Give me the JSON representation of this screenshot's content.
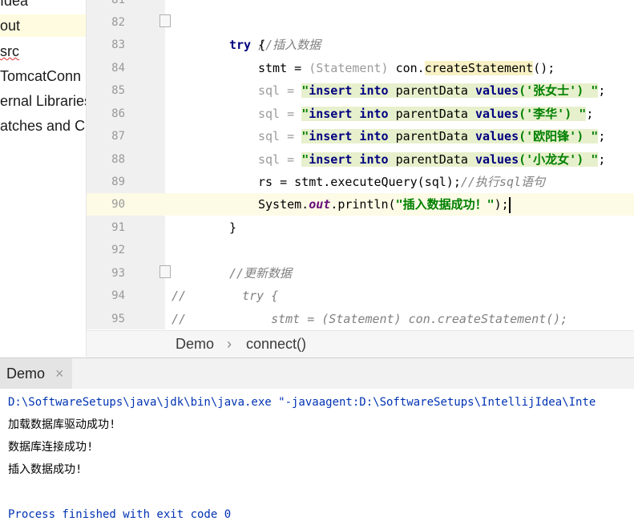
{
  "project_tree": {
    "items": [
      {
        "label": "Idea"
      },
      {
        "label": "out"
      },
      {
        "label": "src"
      },
      {
        "label": "TomcatConn"
      },
      {
        "label": "ernal Libraries"
      },
      {
        "label": "atches and Co"
      }
    ]
  },
  "editor": {
    "line_numbers": [
      "81",
      "82",
      "83",
      "84",
      "85",
      "86",
      "87",
      "88",
      "89",
      "90",
      "91",
      "92",
      "93",
      "94",
      "95"
    ],
    "current_line": "90",
    "lines": {
      "l82_comment": "//插入数据",
      "l83_try": "try",
      "l83_brace": " {",
      "l84_a": "stmt = ",
      "l84_cast": "(Statement)",
      "l84_b": " con.",
      "l84_call": "createStatement",
      "l84_c": "();",
      "l85_a": "sql = ",
      "l85_q": "\"",
      "l85_k1": "insert into",
      "l85_t": " parentData ",
      "l85_k2": "values",
      "l85_v": "('张女士')",
      "l85_q2": " \"",
      "l85_end": ";",
      "l86_v": "('李华')",
      "l87_v": "('欧阳锋')",
      "l88_v": "('小龙女')",
      "l89_a": "rs = stmt.executeQuery(sql);",
      "l89_com": "//执行sql语句",
      "l90_a": "System.",
      "l90_field": "out",
      "l90_b": ".println(",
      "l90_str": "\"插入数据成功！\"",
      "l90_c": ");",
      "l91_brace": "}",
      "l93_comment": "//更新数据",
      "l94_slashes": "//",
      "l94_code": "try {",
      "l95_slashes": "//",
      "l95_code": "stmt = (Statement) con.createStatement();"
    }
  },
  "breadcrumb": {
    "class_name": "Demo",
    "separator": "›",
    "method_name": "connect()"
  },
  "run_panel": {
    "tab_label": "Demo",
    "close_glyph": "×"
  },
  "console": {
    "lines": [
      "D:\\SoftwareSetups\\java\\jdk\\bin\\java.exe \"-javaagent:D:\\SoftwareSetups\\IntellijIdea\\Inte",
      "加载数据库驱动成功!",
      "数据库连接成功!",
      "插入数据成功!",
      "",
      "Process finished with exit code 0"
    ]
  },
  "colors": {
    "keyword": "#000080",
    "string": "#008000",
    "comment": "#808080",
    "console_link": "#0033b3",
    "caret_row": "#fdfae6"
  }
}
